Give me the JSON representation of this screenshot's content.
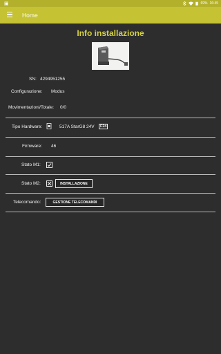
{
  "status_bar": {
    "time": "16:45",
    "battery": "69%"
  },
  "app_bar": {
    "title": "Home"
  },
  "page": {
    "title": "Info installazione"
  },
  "info": {
    "sn_label": "SN:",
    "sn_value": "4294951255",
    "config_label": "Configurazione:",
    "config_value": "Modus",
    "moves_label": "Movimentazioni/Totale:",
    "moves_value": "0/0",
    "hw_label": "Tipo Hardware:",
    "hw_value": "517A StarG8 24V",
    "hw_badge": "F24",
    "fw_label": "Firmware:",
    "fw_value": "46",
    "m1_label": "Stato M1:",
    "m2_label": "Stato M2:",
    "install_button": "INSTALLAZIONE",
    "remote_label": "Telecomando:",
    "remote_button": "GESTIONE TELECOMANDI"
  },
  "colors": {
    "status_bar": "#b3b12c",
    "app_bar": "#c5c233",
    "title": "#d4d045",
    "background": "#2d2d2d"
  }
}
